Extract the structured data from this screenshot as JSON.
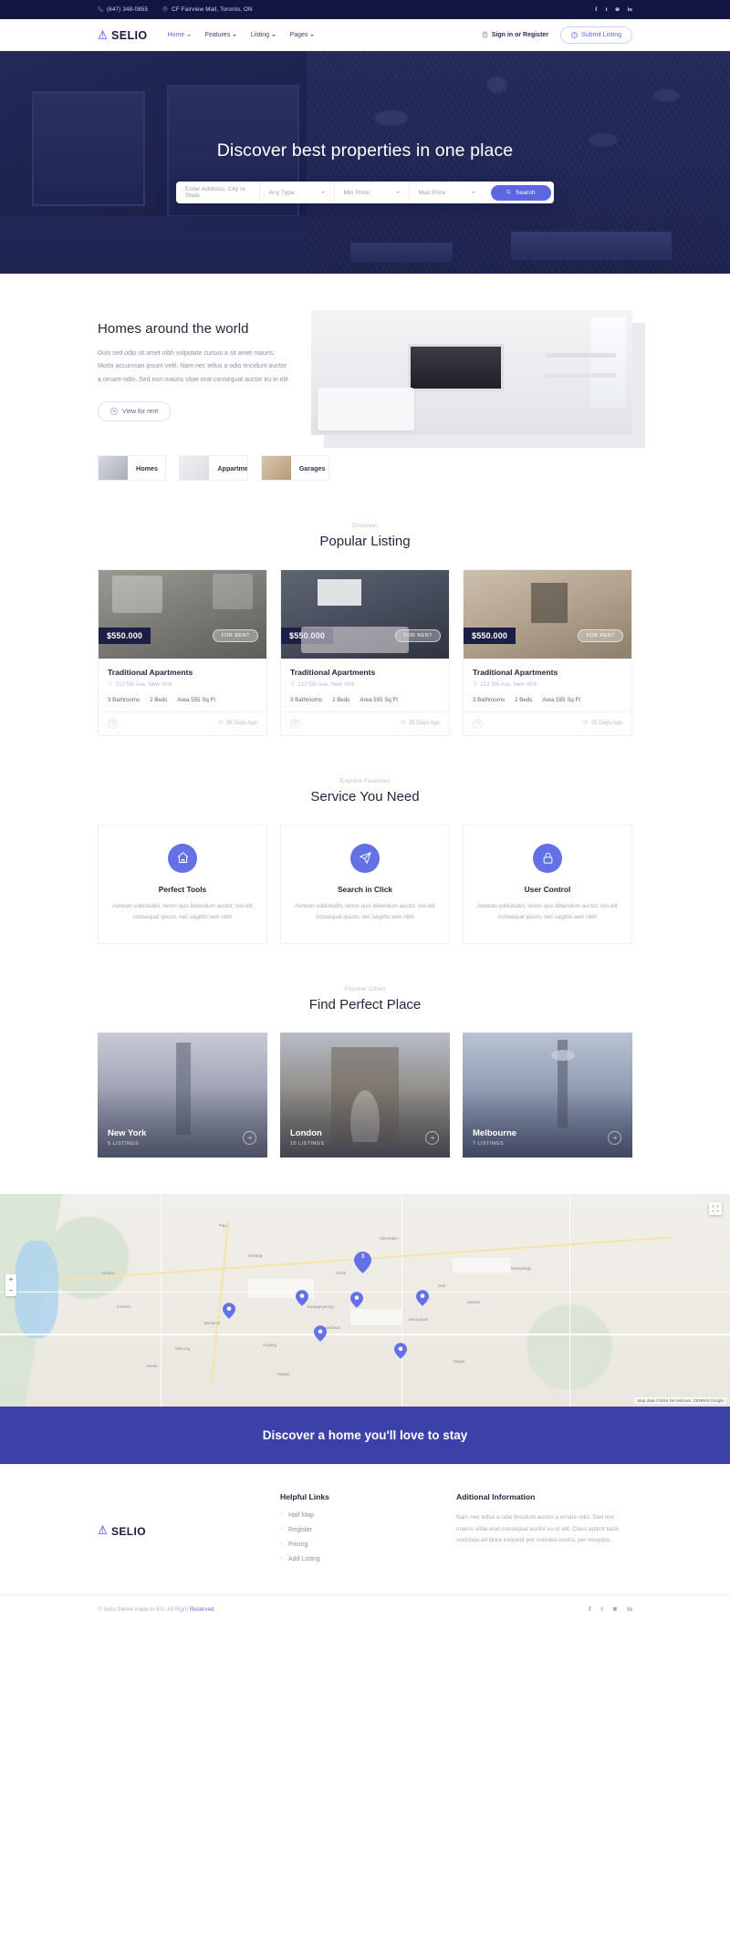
{
  "topbar": {
    "phone": "(647) 348-0855",
    "address": "CF Fairview Mall, Toronto, ON",
    "socials": [
      {
        "name": "facebook-icon",
        "glyph": "f"
      },
      {
        "name": "twitter-icon",
        "glyph": "t"
      },
      {
        "name": "instagram-icon",
        "glyph": "◙"
      },
      {
        "name": "linkedin-icon",
        "glyph": "in"
      }
    ]
  },
  "nav": {
    "brand": "SELIO",
    "menu": [
      {
        "label": "Home",
        "active": true
      },
      {
        "label": "Features",
        "active": false
      },
      {
        "label": "Listing",
        "active": false
      },
      {
        "label": "Pages",
        "active": false
      }
    ],
    "signin": "Sign in or Register",
    "submit": "Submit Listing"
  },
  "hero": {
    "title": "Discover best properties in one place",
    "search": {
      "address_placeholder": "Enter Address, City or State",
      "type": "Any Type",
      "min_price": "Min Price",
      "max_price": "Max Price",
      "button": "Search"
    }
  },
  "around": {
    "title": "Homes around the world",
    "paragraph": "Duis sed odio sit amet nibh vulputate cursus a sit amet mauris. Morbi accumsan ipsum velit. Nam nec tellus a odio tincidunt auctor a ornare odio. Sed non mauris vitae erat consequat auctor eu in elit.",
    "button": "View for rent",
    "tabs": [
      {
        "label": "Homes"
      },
      {
        "label": "Appartments"
      },
      {
        "label": "Garages"
      }
    ]
  },
  "popular": {
    "kicker": "Discover",
    "title": "Popular Listing",
    "cards": [
      {
        "price": "$550.000",
        "badge": "FOR RENT",
        "title": "Traditional Apartments",
        "address": "212 5th Ave, New York",
        "bathrooms": "3 Bathrooms",
        "beds": "2 Beds",
        "area": "Area 555 Sq Ft",
        "ago": "35 Days Ago"
      },
      {
        "price": "$550.000",
        "badge": "FOR RENT",
        "title": "Traditional Apartments",
        "address": "212 5th Ave, New York",
        "bathrooms": "3 Bathrooms",
        "beds": "2 Beds",
        "area": "Area 555 Sq Ft",
        "ago": "35 Days Ago"
      },
      {
        "price": "$550.000",
        "badge": "FOR RENT",
        "title": "Traditional Apartments",
        "address": "212 5th Ave, New York",
        "bathrooms": "3 Bathrooms",
        "beds": "2 Beds",
        "area": "Area 555 Sq Ft",
        "ago": "35 Days Ago"
      }
    ]
  },
  "services": {
    "kicker": "Explore Features",
    "title": "Service You Need",
    "items": [
      {
        "icon": "home-icon",
        "title": "Perfect Tools",
        "text": "Aenean sollicitudin, lorem quis bibendum auctor, nisi elit consequat ipsum, nec sagittis sem nibh"
      },
      {
        "icon": "paper-plane-icon",
        "title": "Search in Click",
        "text": "Aenean sollicitudin, lorem quis bibendum auctor, nisi elit consequat ipsum, nec sagittis sem nibh"
      },
      {
        "icon": "lock-icon",
        "title": "User Control",
        "text": "Aenean sollicitudin, lorem quis bibendum auctor, nisi elit consequat ipsum, nec sagittis sem nibh"
      }
    ]
  },
  "cities": {
    "kicker": "Popular Cities",
    "title": "Find Perfect Place",
    "items": [
      {
        "name": "New York",
        "listings": "5 LISTINGS"
      },
      {
        "name": "London",
        "listings": "10 LISTINGS"
      },
      {
        "name": "Melbourne",
        "listings": "7 LISTINGS"
      }
    ]
  },
  "map": {
    "cluster_count": "3",
    "attribution": "Map data ©2019 SK telecom, ZENRIN Google",
    "zoom_in": "+",
    "zoom_out": "−",
    "labels": [
      "Seoul",
      "Incheon",
      "Bucheon",
      "Anyang",
      "Seongnam",
      "Gwangmyeong",
      "Hanam",
      "Guri",
      "Goyang",
      "Uijeongbu",
      "Siheung",
      "Gwacheon",
      "Suwon",
      "Yongin",
      "Ansan",
      "Gimpo",
      "Paju",
      "Namyangju"
    ]
  },
  "cta": {
    "title": "Discover a home you'll love to stay"
  },
  "footer": {
    "brand": "SELIO",
    "links_title": "Helpful Links",
    "links": [
      "Half Map",
      "Register",
      "Pricing",
      "Add Listing"
    ],
    "info_title": "Aditional Information",
    "info_text": "Nam nec tellus a odio tincidunt auctor a ornare odio. Sed non mauris vitae erat consequat auctor eu in elit. Class aptent taciti sociosqu ad litora torquent per conubia nostra, per inceptos.",
    "copyright_pre": "© Selio theme made in EU. All Right ",
    "copyright_link": "Reserved",
    "socials": [
      {
        "name": "facebook-icon",
        "glyph": "f"
      },
      {
        "name": "twitter-icon",
        "glyph": "t"
      },
      {
        "name": "instagram-icon",
        "glyph": "◙"
      },
      {
        "name": "linkedin-icon",
        "glyph": "in"
      }
    ]
  },
  "colors": {
    "accent": "#5b66e0",
    "dark": "#121442",
    "cta_bg": "#3b41a8"
  }
}
